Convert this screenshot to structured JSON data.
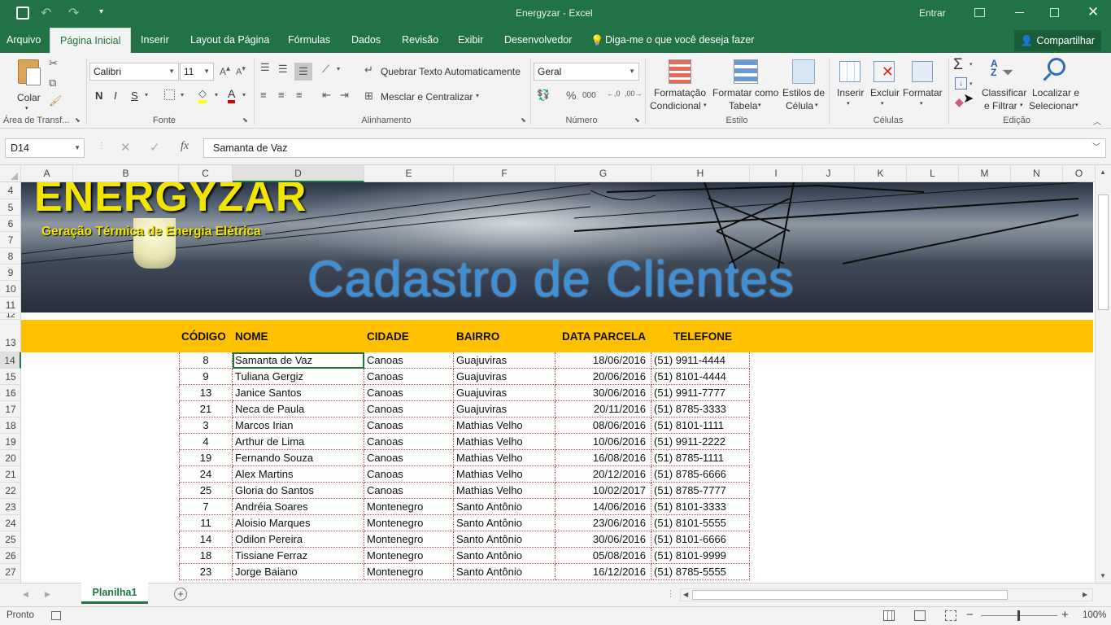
{
  "app": {
    "title": "Energyzar  -  Excel",
    "signin": "Entrar",
    "share": "Compartilhar"
  },
  "tabs": [
    "Arquivo",
    "Página Inicial",
    "Inserir",
    "Layout da Página",
    "Fórmulas",
    "Dados",
    "Revisão",
    "Exibir",
    "Desenvolvedor"
  ],
  "tellme": "Diga-me o que você deseja fazer",
  "ribbon": {
    "clipboard": {
      "paste": "Colar",
      "label": "Área de Transf..."
    },
    "font": {
      "name": "Calibri",
      "size": "11",
      "bold": "N",
      "italic": "I",
      "underline": "S",
      "label": "Fonte"
    },
    "alignment": {
      "wrap": "Quebrar Texto Automaticamente",
      "merge": "Mesclar e Centralizar",
      "label": "Alinhamento"
    },
    "number": {
      "format": "Geral",
      "label": "Número"
    },
    "styles": {
      "cond": [
        "Formatação",
        "Condicional"
      ],
      "table": [
        "Formatar como",
        "Tabela"
      ],
      "cell": [
        "Estilos de",
        "Célula"
      ],
      "label": "Estilo"
    },
    "cells": {
      "insert": "Inserir",
      "delete": "Excluir",
      "format": "Formatar",
      "label": "Células"
    },
    "editing": {
      "sort": [
        "Classificar",
        "e Filtrar"
      ],
      "find": [
        "Localizar e",
        "Selecionar"
      ],
      "label": "Edição"
    }
  },
  "formula": {
    "namebox": "D14",
    "value": "Samanta de Vaz"
  },
  "columns": [
    "A",
    "B",
    "C",
    "D",
    "E",
    "F",
    "G",
    "H",
    "I",
    "J",
    "K",
    "L",
    "M",
    "N",
    "O"
  ],
  "rows": [
    "4",
    "5",
    "6",
    "7",
    "8",
    "9",
    "10",
    "11",
    "12",
    "13",
    "14",
    "15",
    "16",
    "17",
    "18",
    "19",
    "20",
    "21",
    "22",
    "23",
    "24",
    "25",
    "26",
    "27"
  ],
  "banner": {
    "brand": "ENERGYZAR",
    "subtitle": "Geração Térmica de Energia Elétrica",
    "title": "Cadastro de Clientes"
  },
  "table": {
    "headers": [
      "CÓDIGO",
      "NOME",
      "CIDADE",
      "BAIRRO",
      "DATA PARCELA",
      "TELEFONE"
    ],
    "rows": [
      [
        "8",
        "Samanta de Vaz",
        "Canoas",
        "Guajuviras",
        "18/06/2016",
        "(51) 9911-4444"
      ],
      [
        "9",
        "Tuliana Gergiz",
        "Canoas",
        "Guajuviras",
        "20/06/2016",
        "(51) 8101-4444"
      ],
      [
        "13",
        "Janice Santos",
        "Canoas",
        "Guajuviras",
        "30/06/2016",
        "(51) 9911-7777"
      ],
      [
        "21",
        "Neca de Paula",
        "Canoas",
        "Guajuviras",
        "20/11/2016",
        "(51) 8785-3333"
      ],
      [
        "3",
        "Marcos Irian",
        "Canoas",
        "Mathias Velho",
        "08/06/2016",
        "(51) 8101-1111"
      ],
      [
        "4",
        "Arthur de Lima",
        "Canoas",
        "Mathias Velho",
        "10/06/2016",
        "(51) 9911-2222"
      ],
      [
        "19",
        "Fernando Souza",
        "Canoas",
        "Mathias Velho",
        "16/08/2016",
        "(51) 8785-1111"
      ],
      [
        "24",
        "Alex Martins",
        "Canoas",
        "Mathias Velho",
        "20/12/2016",
        "(51) 8785-6666"
      ],
      [
        "25",
        "Gloria do Santos",
        "Canoas",
        "Mathias Velho",
        "10/02/2017",
        "(51) 8785-7777"
      ],
      [
        "7",
        "Andréia Soares",
        "Montenegro",
        "Santo Antônio",
        "14/06/2016",
        "(51) 8101-3333"
      ],
      [
        "11",
        "Aloisio Marques",
        "Montenegro",
        "Santo Antônio",
        "23/06/2016",
        "(51) 8101-5555"
      ],
      [
        "14",
        "Odilon Pereira",
        "Montenegro",
        "Santo Antônio",
        "30/06/2016",
        "(51) 8101-6666"
      ],
      [
        "18",
        "Tissiane Ferraz",
        "Montenegro",
        "Santo Antônio",
        "05/08/2016",
        "(51) 8101-9999"
      ],
      [
        "23",
        "Jorge Baiano",
        "Montenegro",
        "Santo Antônio",
        "16/12/2016",
        "(51) 8785-5555"
      ]
    ]
  },
  "sheet": {
    "tab": "Planilha1"
  },
  "status": {
    "ready": "Pronto",
    "zoom": "100%"
  },
  "colors": {
    "excel_green": "#217346",
    "header_yellow": "#ffc000",
    "brand_yellow": "#f2e600",
    "title_blue": "#3d8fd6"
  }
}
